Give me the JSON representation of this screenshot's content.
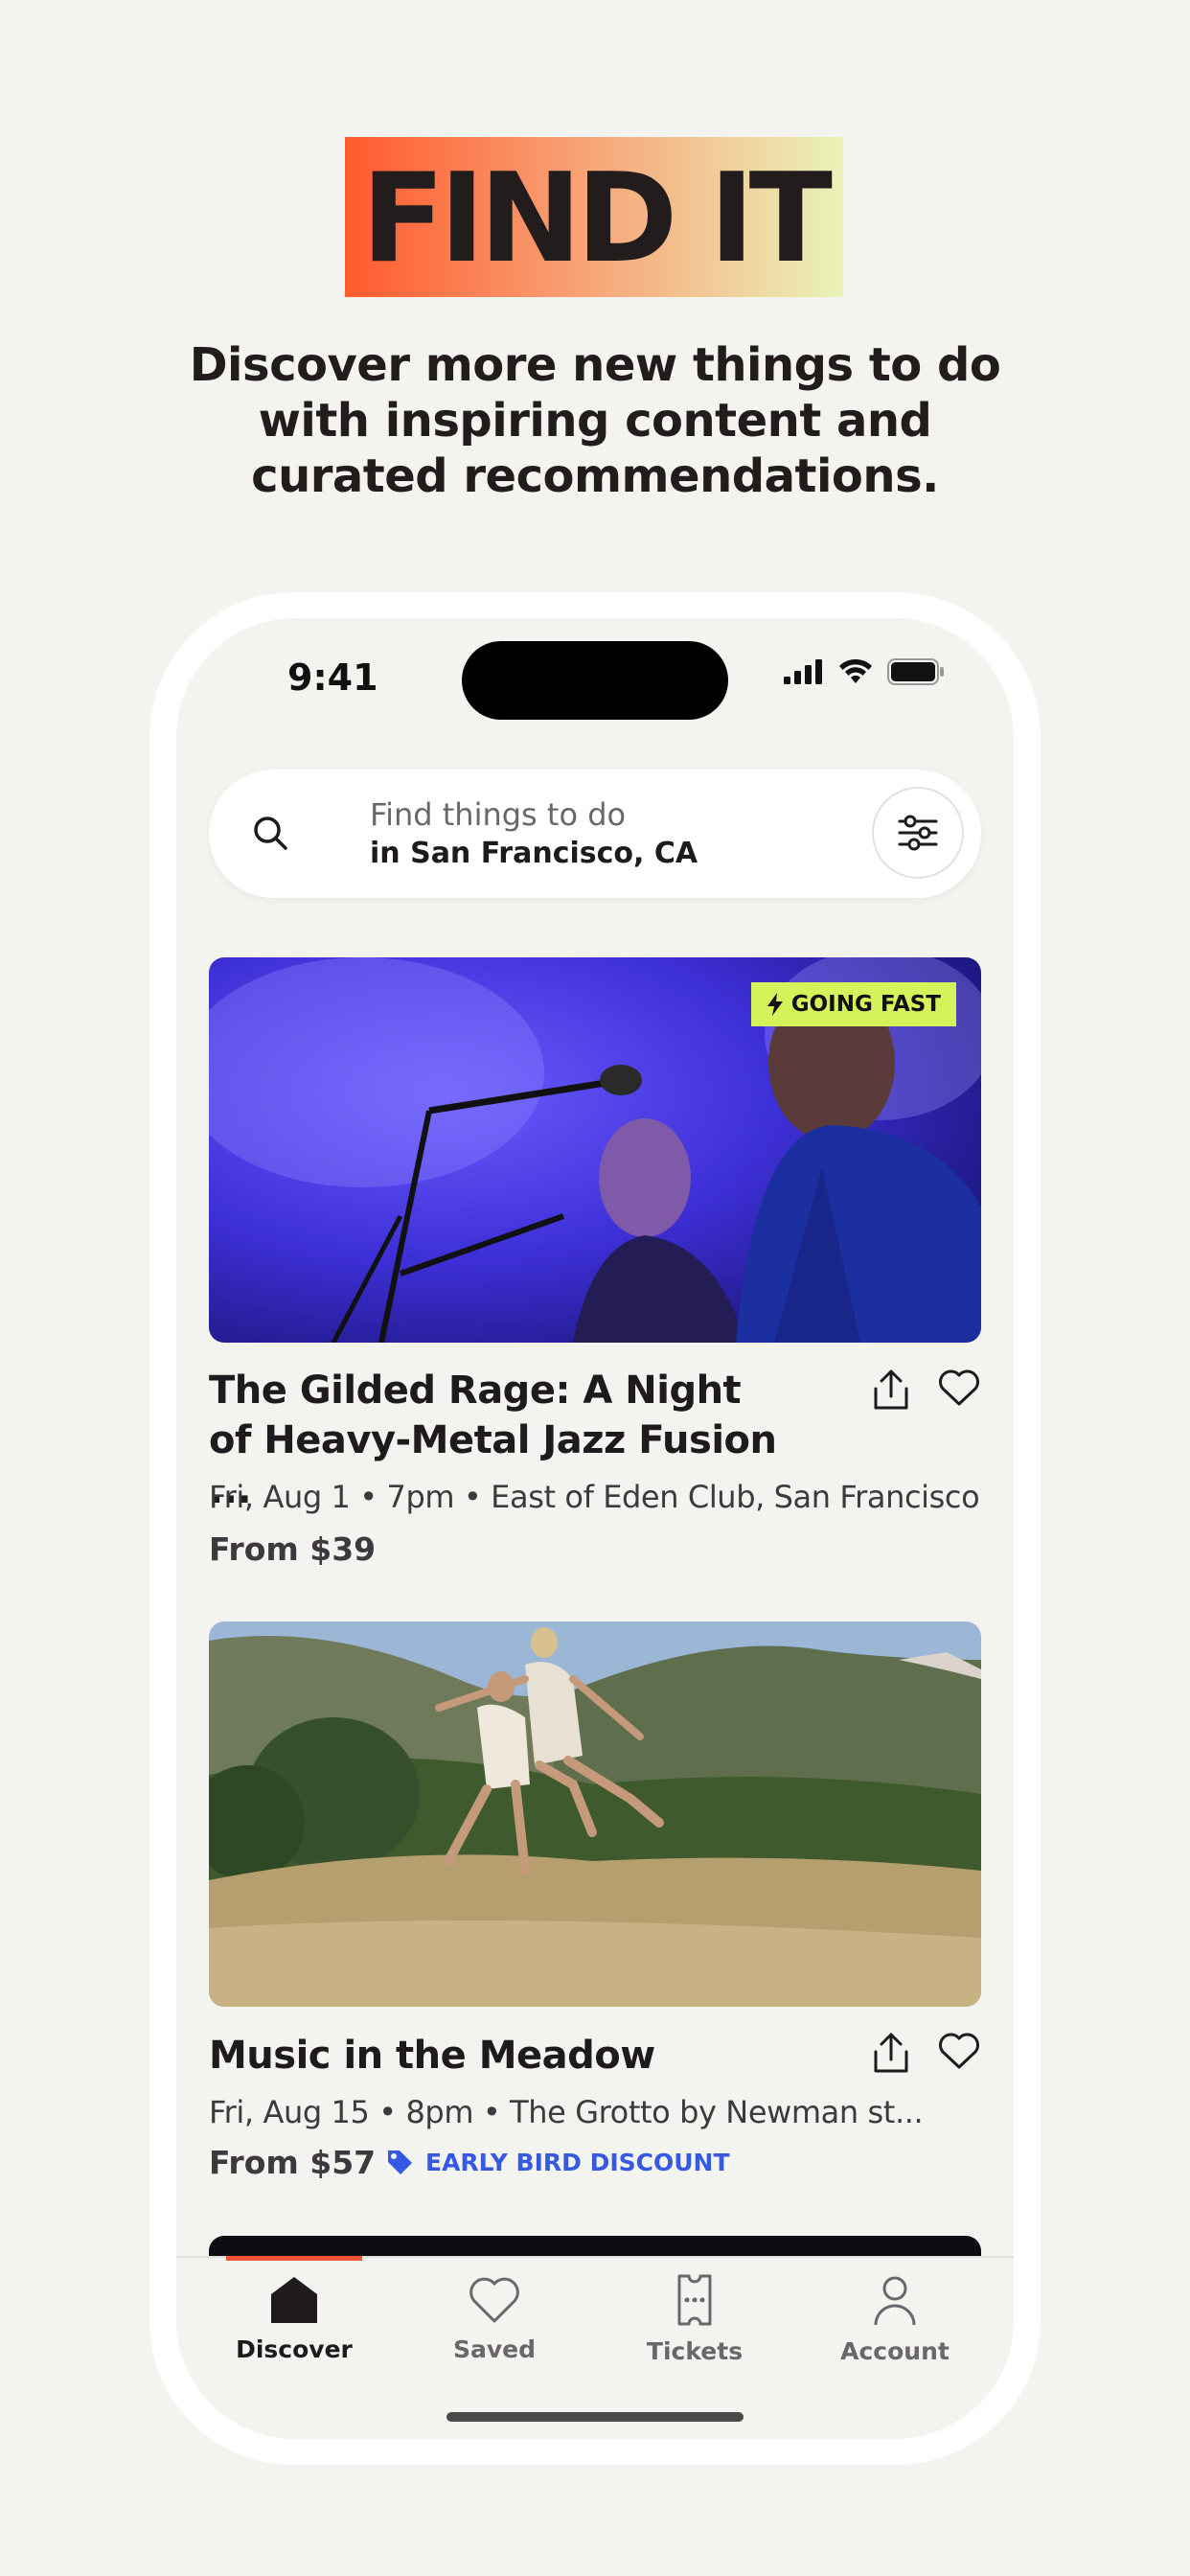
{
  "promo": {
    "title": "FIND IT",
    "subtitle": "Discover more new things to do with inspiring content and curated recommendations."
  },
  "status_bar": {
    "time": "9:41"
  },
  "search": {
    "placeholder": "Find things to do",
    "location": "in San Francisco, CA"
  },
  "events": [
    {
      "title": "The Gilded Rage: A Night of Heavy-Metal Jazz Fusion ...",
      "meta": "Fri, Aug 1 • 7pm • East of Eden Club, San Francisco,...",
      "price": "From $39",
      "badge": "GOING FAST"
    },
    {
      "title": "Music in the Meadow",
      "meta": "Fri, Aug 15 • 8pm • The Grotto by Newman st...",
      "price": "From $57",
      "discount": "EARLY BIRD DISCOUNT"
    }
  ],
  "tabs": [
    {
      "label": "Discover",
      "icon": "home-icon",
      "active": true
    },
    {
      "label": "Saved",
      "icon": "heart-icon",
      "active": false
    },
    {
      "label": "Tickets",
      "icon": "ticket-icon",
      "active": false
    },
    {
      "label": "Account",
      "icon": "person-icon",
      "active": false
    }
  ],
  "colors": {
    "background": "#f3f3ef",
    "badge_green": "#d6f25b",
    "discount_blue": "#3659e3",
    "tab_accent": "#f05537"
  }
}
